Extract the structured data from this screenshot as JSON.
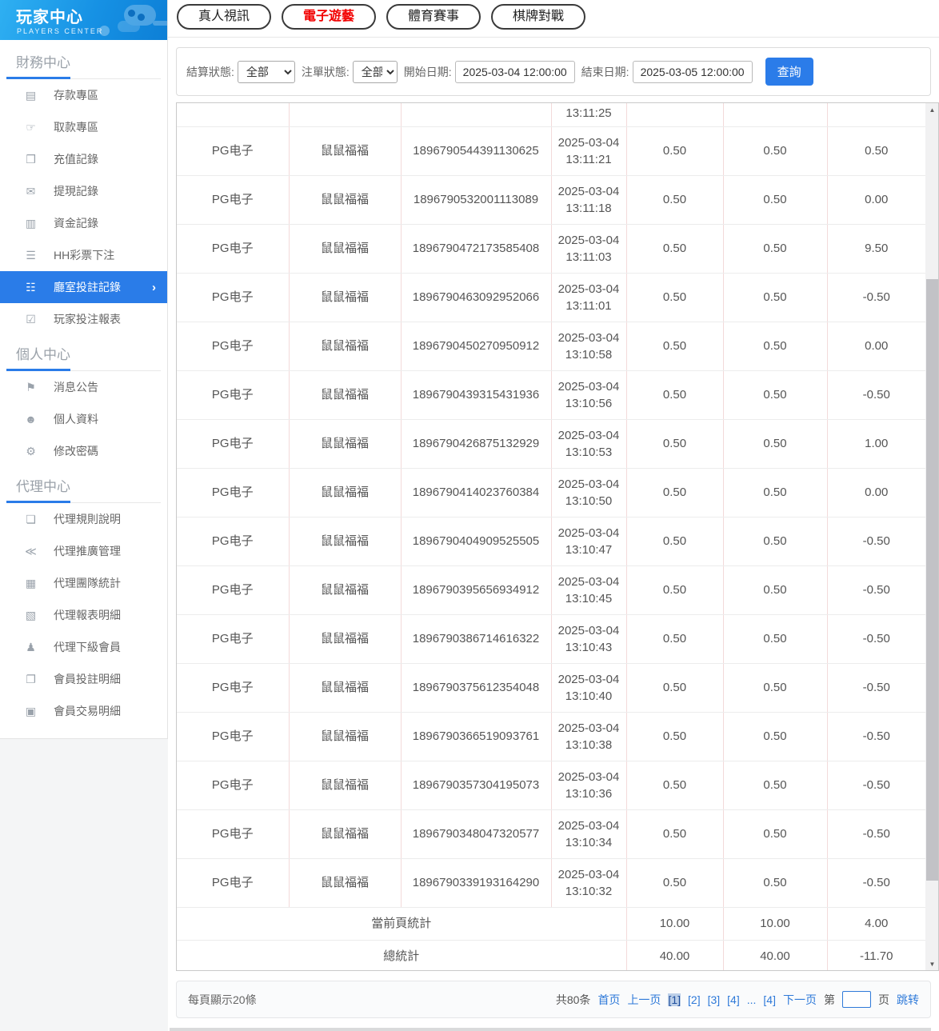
{
  "colors": {
    "accent_blue": "#2a7ce8",
    "active_tab_red": "#f20000",
    "link_blue": "#2f7ad9",
    "header_gradient_start": "#2fb0f2",
    "header_gradient_end": "#0d7fd6"
  },
  "sidebar": {
    "title": "玩家中心",
    "subtitle": "PLAYERS CENTER",
    "sections": [
      {
        "heading": "財務中心",
        "items": [
          {
            "label": "存款專區",
            "icon": "deposit-card-icon",
            "glyph": "▤",
            "active": false
          },
          {
            "label": "取款專區",
            "icon": "withdraw-hand-icon",
            "glyph": "☞",
            "active": false
          },
          {
            "label": "充值記錄",
            "icon": "moneybag-icon",
            "glyph": "❒",
            "active": false
          },
          {
            "label": "提現記錄",
            "icon": "wallet-icon",
            "glyph": "✉",
            "active": false
          },
          {
            "label": "資金記錄",
            "icon": "funds-record-icon",
            "glyph": "▥",
            "active": false
          },
          {
            "label": "HH彩票下注",
            "icon": "lottery-document-icon",
            "glyph": "☰",
            "active": false
          },
          {
            "label": "廳室投註記錄",
            "icon": "bet-record-list-icon",
            "glyph": "☷",
            "active": true
          },
          {
            "label": "玩家投注報表",
            "icon": "bet-report-icon",
            "glyph": "☑",
            "active": false
          }
        ]
      },
      {
        "heading": "個人中心",
        "items": [
          {
            "label": "消息公告",
            "icon": "bell-icon",
            "glyph": "⚑",
            "active": false
          },
          {
            "label": "個人資料",
            "icon": "person-icon",
            "glyph": "☻",
            "active": false
          },
          {
            "label": "修改密碼",
            "icon": "gear-icon",
            "glyph": "⚙",
            "active": false
          }
        ]
      },
      {
        "heading": "代理中心",
        "items": [
          {
            "label": "代理規則說明",
            "icon": "file-icon",
            "glyph": "❏",
            "active": false
          },
          {
            "label": "代理推廣管理",
            "icon": "share-icon",
            "glyph": "≪",
            "active": false
          },
          {
            "label": "代理團隊統計",
            "icon": "team-stats-icon",
            "glyph": "▦",
            "active": false
          },
          {
            "label": "代理報表明細",
            "icon": "report-detail-icon",
            "glyph": "▧",
            "active": false
          },
          {
            "label": "代理下級會員",
            "icon": "users-icon",
            "glyph": "♟",
            "active": false
          },
          {
            "label": "會員投註明細",
            "icon": "clipboard-icon",
            "glyph": "❐",
            "active": false
          },
          {
            "label": "會員交易明細",
            "icon": "transaction-list-icon",
            "glyph": "▣",
            "active": false
          }
        ]
      }
    ]
  },
  "tabs": [
    {
      "label": "真人視訊",
      "active": false
    },
    {
      "label": "電子遊藝",
      "active": true
    },
    {
      "label": "體育賽事",
      "active": false
    },
    {
      "label": "棋牌對戰",
      "active": false
    }
  ],
  "filters": {
    "settle_status_label": "結算狀態:",
    "settle_status_value": "全部",
    "order_status_label": "注單狀態:",
    "order_status_value": "全部",
    "start_date_label": "開始日期:",
    "start_date_value": "2025-03-04 12:00:00",
    "end_date_label": "結束日期:",
    "end_date_value": "2025-03-05 12:00:00",
    "search_button": "查詢"
  },
  "table": {
    "partial_row_time": "13:11:25",
    "rows": [
      {
        "provider": "PG电子",
        "game": "鼠鼠福福",
        "order_no": "1896790544391130625",
        "date": "2025-03-04",
        "time": "13:11:21",
        "bet": "0.50",
        "valid": "0.50",
        "result": "0.50"
      },
      {
        "provider": "PG电子",
        "game": "鼠鼠福福",
        "order_no": "1896790532001113089",
        "date": "2025-03-04",
        "time": "13:11:18",
        "bet": "0.50",
        "valid": "0.50",
        "result": "0.00"
      },
      {
        "provider": "PG电子",
        "game": "鼠鼠福福",
        "order_no": "1896790472173585408",
        "date": "2025-03-04",
        "time": "13:11:03",
        "bet": "0.50",
        "valid": "0.50",
        "result": "9.50"
      },
      {
        "provider": "PG电子",
        "game": "鼠鼠福福",
        "order_no": "1896790463092952066",
        "date": "2025-03-04",
        "time": "13:11:01",
        "bet": "0.50",
        "valid": "0.50",
        "result": "-0.50"
      },
      {
        "provider": "PG电子",
        "game": "鼠鼠福福",
        "order_no": "1896790450270950912",
        "date": "2025-03-04",
        "time": "13:10:58",
        "bet": "0.50",
        "valid": "0.50",
        "result": "0.00"
      },
      {
        "provider": "PG电子",
        "game": "鼠鼠福福",
        "order_no": "1896790439315431936",
        "date": "2025-03-04",
        "time": "13:10:56",
        "bet": "0.50",
        "valid": "0.50",
        "result": "-0.50"
      },
      {
        "provider": "PG电子",
        "game": "鼠鼠福福",
        "order_no": "1896790426875132929",
        "date": "2025-03-04",
        "time": "13:10:53",
        "bet": "0.50",
        "valid": "0.50",
        "result": "1.00"
      },
      {
        "provider": "PG电子",
        "game": "鼠鼠福福",
        "order_no": "1896790414023760384",
        "date": "2025-03-04",
        "time": "13:10:50",
        "bet": "0.50",
        "valid": "0.50",
        "result": "0.00"
      },
      {
        "provider": "PG电子",
        "game": "鼠鼠福福",
        "order_no": "1896790404909525505",
        "date": "2025-03-04",
        "time": "13:10:47",
        "bet": "0.50",
        "valid": "0.50",
        "result": "-0.50"
      },
      {
        "provider": "PG电子",
        "game": "鼠鼠福福",
        "order_no": "1896790395656934912",
        "date": "2025-03-04",
        "time": "13:10:45",
        "bet": "0.50",
        "valid": "0.50",
        "result": "-0.50"
      },
      {
        "provider": "PG电子",
        "game": "鼠鼠福福",
        "order_no": "1896790386714616322",
        "date": "2025-03-04",
        "time": "13:10:43",
        "bet": "0.50",
        "valid": "0.50",
        "result": "-0.50"
      },
      {
        "provider": "PG电子",
        "game": "鼠鼠福福",
        "order_no": "1896790375612354048",
        "date": "2025-03-04",
        "time": "13:10:40",
        "bet": "0.50",
        "valid": "0.50",
        "result": "-0.50"
      },
      {
        "provider": "PG电子",
        "game": "鼠鼠福福",
        "order_no": "1896790366519093761",
        "date": "2025-03-04",
        "time": "13:10:38",
        "bet": "0.50",
        "valid": "0.50",
        "result": "-0.50"
      },
      {
        "provider": "PG电子",
        "game": "鼠鼠福福",
        "order_no": "1896790357304195073",
        "date": "2025-03-04",
        "time": "13:10:36",
        "bet": "0.50",
        "valid": "0.50",
        "result": "-0.50"
      },
      {
        "provider": "PG电子",
        "game": "鼠鼠福福",
        "order_no": "1896790348047320577",
        "date": "2025-03-04",
        "time": "13:10:34",
        "bet": "0.50",
        "valid": "0.50",
        "result": "-0.50"
      },
      {
        "provider": "PG电子",
        "game": "鼠鼠福福",
        "order_no": "1896790339193164290",
        "date": "2025-03-04",
        "time": "13:10:32",
        "bet": "0.50",
        "valid": "0.50",
        "result": "-0.50"
      }
    ],
    "summary_rows": [
      {
        "label": "當前頁統計",
        "bet": "10.00",
        "valid": "10.00",
        "result": "4.00"
      },
      {
        "label": "總統計",
        "bet": "40.00",
        "valid": "40.00",
        "result": "-11.70"
      }
    ]
  },
  "scrollbar": {
    "up_arrow": "▲",
    "down_arrow": "▼"
  },
  "footer": {
    "page_size_text": "每頁顯示20條",
    "total_text": "共80条",
    "first": "首页",
    "prev": "上一页",
    "pages": [
      "1",
      "2",
      "3",
      "4"
    ],
    "current_page": "1",
    "ellipsis": "...",
    "last_page": "4",
    "next": "下一页",
    "jump_prefix": "第",
    "jump_suffix": "页",
    "jump_button": "跳转"
  }
}
